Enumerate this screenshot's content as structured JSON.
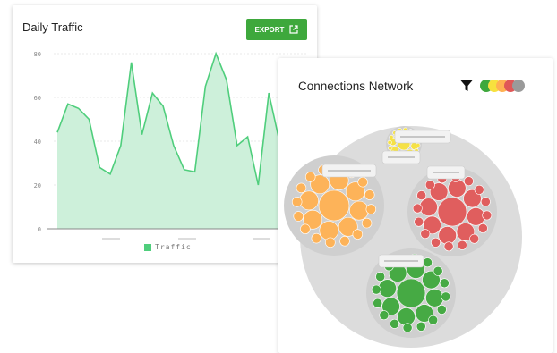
{
  "traffic": {
    "title": "Daily Traffic",
    "export_label": "EXPORT",
    "legend_label": "Traffic"
  },
  "chart_data": {
    "type": "area",
    "xlabel": "",
    "ylabel": "",
    "ylim": [
      0,
      80
    ],
    "yticks": [
      "80",
      "60",
      "40",
      "20",
      "0"
    ],
    "series": [
      {
        "name": "Traffic",
        "color": "#4fce7c",
        "values": [
          44,
          57,
          55,
          50,
          28,
          25,
          38,
          76,
          43,
          62,
          56,
          38,
          27,
          26,
          65,
          80,
          68,
          38,
          42,
          20,
          62,
          40
        ]
      }
    ],
    "grid": true,
    "legend_position": "bottom"
  },
  "network": {
    "title": "Connections Network",
    "filter_icon": "filter-icon",
    "legend_colors": [
      "#3ea83c",
      "#f7e13e",
      "#ffb152",
      "#e05757",
      "#9a9a9a"
    ],
    "groups": [
      {
        "color": "#ffb152"
      },
      {
        "color": "#e05757"
      },
      {
        "color": "#3ea83c"
      },
      {
        "color": "#f7e13e"
      }
    ]
  }
}
